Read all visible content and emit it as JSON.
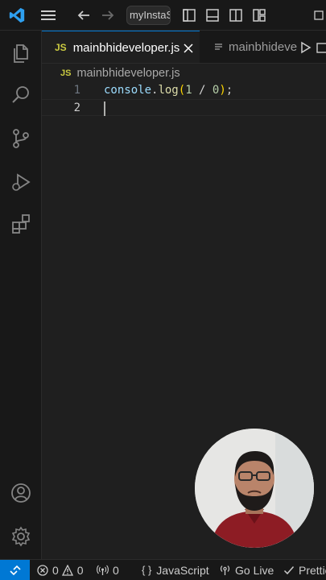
{
  "titlebar": {
    "search_text": "myInstaS"
  },
  "tabs": [
    {
      "badge": "JS",
      "label": "mainbhideveloper.js",
      "active": true
    },
    {
      "label": "mainbhideve",
      "active": false
    }
  ],
  "breadcrumb": {
    "badge": "JS",
    "file": "mainbhideveloper.js"
  },
  "editor": {
    "lines": [
      {
        "number": "1"
      },
      {
        "number": "2"
      }
    ],
    "code_line_1": {
      "obj": "console",
      "dot": ".",
      "method": "log",
      "open": "(",
      "num1": "1",
      "op": " / ",
      "num2": "0",
      "close": ")",
      "semi": ";"
    }
  },
  "statusbar": {
    "errors": "0",
    "warnings": "0",
    "ports": "0",
    "language": "JavaScript",
    "go_live": "Go Live",
    "prettier": "Prettier"
  },
  "colors": {
    "accent": "#0078d4",
    "js_badge": "#cbcb41",
    "keyword_blue": "#9cdcfe",
    "function_yellow": "#dcdcaa",
    "number_green": "#b5cea8"
  }
}
